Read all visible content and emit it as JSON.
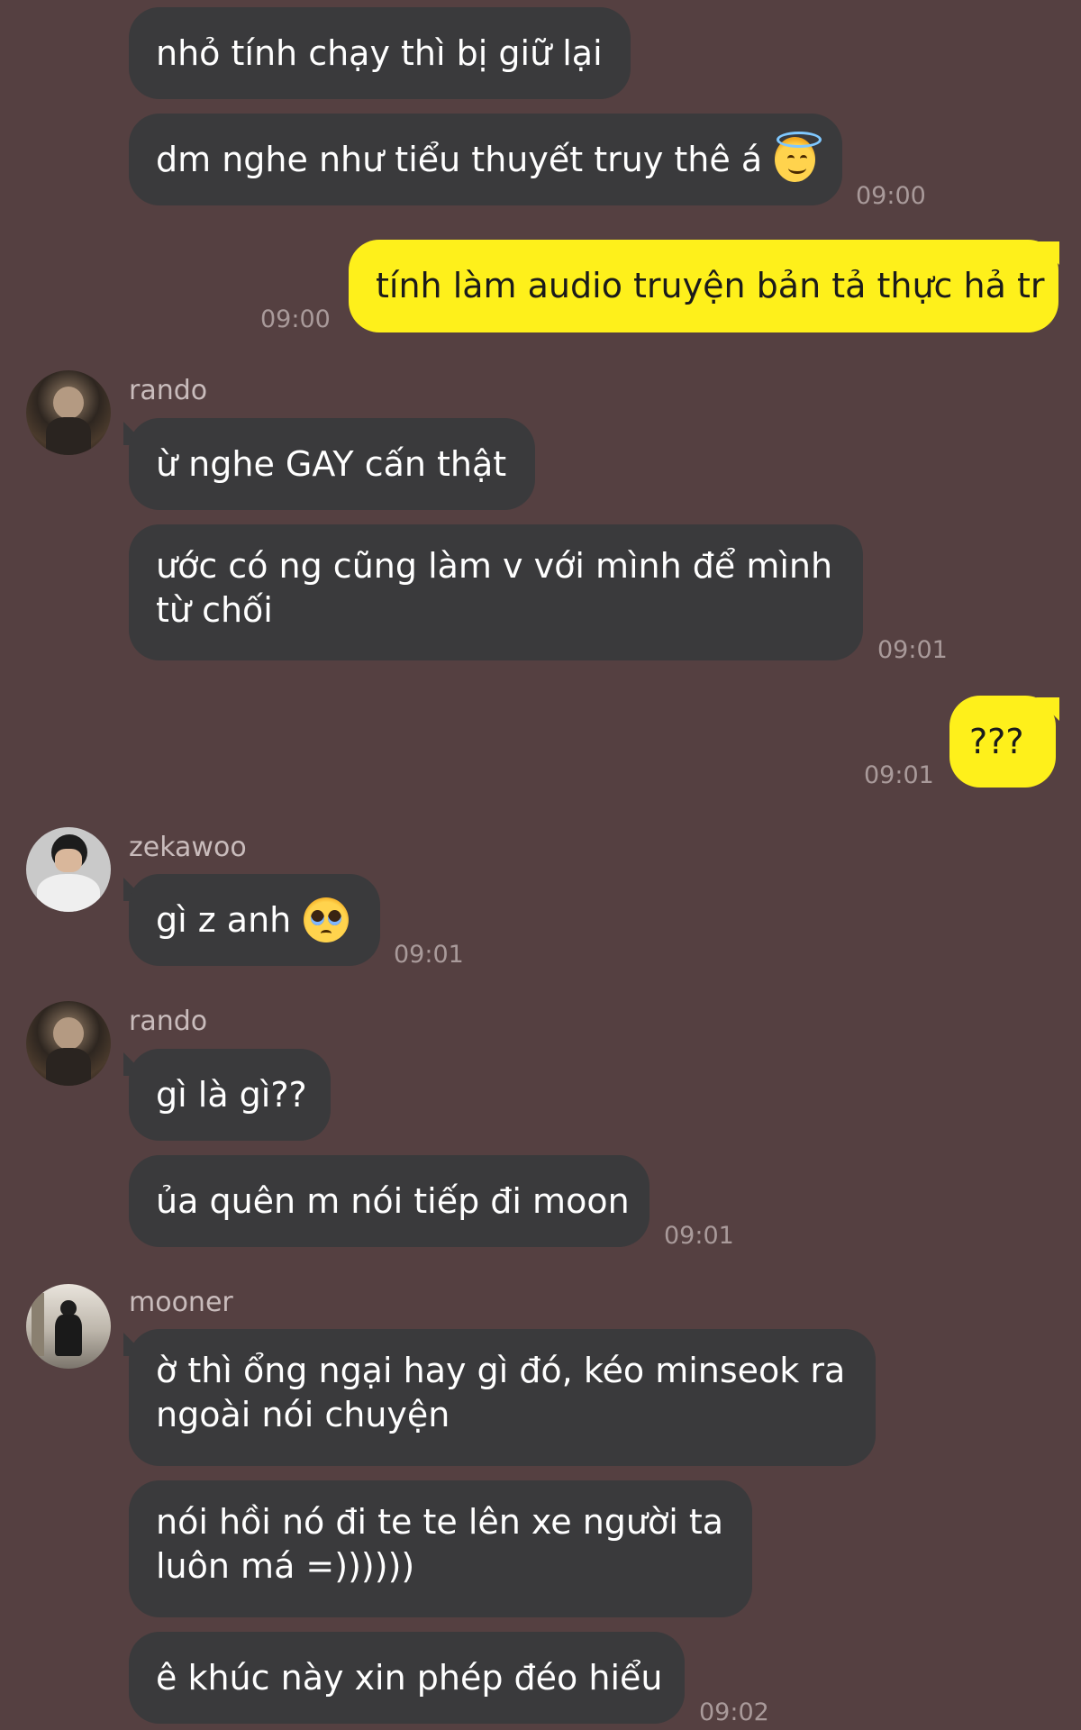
{
  "messages": {
    "m1": {
      "text": "nhỏ tính chạy thì bị giữ lại"
    },
    "m2": {
      "text": "dm nghe như tiểu thuyết truy thê á",
      "emoji": "smiling-face-with-halo-emoji",
      "time": "09:00"
    },
    "m3": {
      "text": "tính làm audio truyện bản tả thực hả tr",
      "time": "09:00"
    },
    "rando1": {
      "sender": "rando",
      "avatar": "rando-avatar"
    },
    "m4": {
      "text": "ừ nghe GAY cấn thật"
    },
    "m5": {
      "line1": "ước có ng cũng làm v với mình để mình",
      "line2": "từ chối",
      "time": "09:01"
    },
    "m6": {
      "text": "???",
      "time": "09:01"
    },
    "zekawoo": {
      "sender": "zekawoo",
      "avatar": "zekawoo-avatar"
    },
    "m7": {
      "text": "gì z anh",
      "emoji": "pleading-face-emoji",
      "time": "09:01"
    },
    "rando2": {
      "sender": "rando",
      "avatar": "rando-avatar"
    },
    "m8": {
      "text": "gì là gì??"
    },
    "m9": {
      "text": "ủa quên m nói tiếp đi moon",
      "time": "09:01"
    },
    "mooner": {
      "sender": "mooner",
      "avatar": "mooner-avatar"
    },
    "m10": {
      "line1": "ờ thì ổng ngại hay gì đó, kéo minseok ra",
      "line2": "ngoài nói chuyện"
    },
    "m11": {
      "line1": "nói hồi nó đi te te lên xe người ta",
      "line2": "luôn má =))))))"
    },
    "m12": {
      "text": "ê khúc này xin phép đéo hiểu",
      "time": "09:02"
    }
  },
  "colors": {
    "background": "#554041",
    "incoming_bubble": "#3a3a3c",
    "outgoing_bubble": "#fef01b",
    "timestamp": "#a99a9a",
    "sender_name": "#c9bcbc"
  }
}
